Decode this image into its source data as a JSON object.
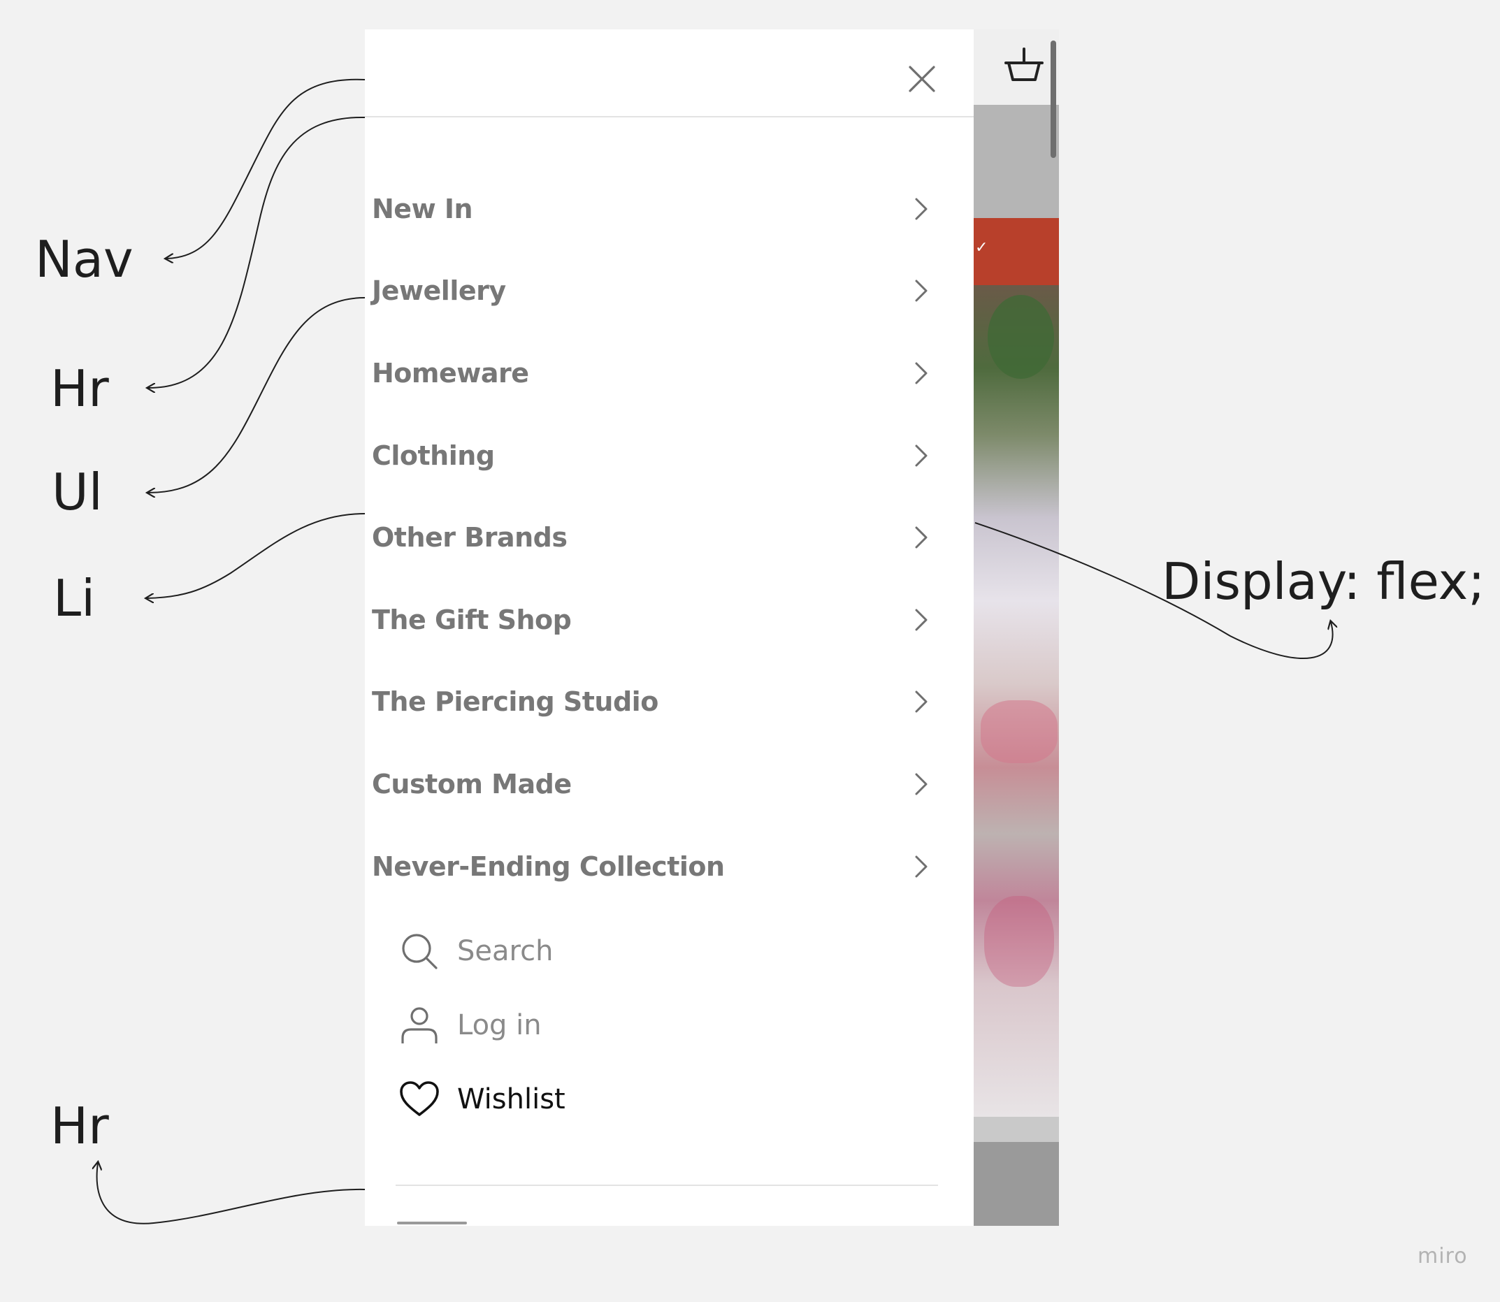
{
  "nav": {
    "close_icon": "close-icon",
    "items": [
      {
        "label": "New In",
        "icon": "chevron-right-icon"
      },
      {
        "label": "Jewellery",
        "icon": "chevron-right-icon"
      },
      {
        "label": "Homeware",
        "icon": "chevron-right-icon"
      },
      {
        "label": "Clothing",
        "icon": "chevron-right-icon"
      },
      {
        "label": "Other Brands",
        "icon": "chevron-right-icon"
      },
      {
        "label": "The Gift Shop",
        "icon": "chevron-right-icon"
      },
      {
        "label": "The Piercing Studio",
        "icon": "chevron-right-icon"
      },
      {
        "label": "Custom Made",
        "icon": "chevron-right-icon"
      },
      {
        "label": "Never-Ending Collection",
        "icon": "chevron-right-icon"
      }
    ],
    "utility": [
      {
        "label": "Search",
        "icon": "search-icon"
      },
      {
        "label": "Log in",
        "icon": "user-icon"
      },
      {
        "label": "Wishlist",
        "icon": "heart-icon"
      }
    ]
  },
  "background": {
    "basket_icon": "basket-icon",
    "accent_color": "#b8402b"
  },
  "annotations": {
    "nav": "Nav",
    "hr_top": "Hr",
    "ul": "Ul",
    "li": "Li",
    "hr_bottom": "Hr",
    "display_flex": "Display: flex;"
  },
  "watermark": "miro"
}
